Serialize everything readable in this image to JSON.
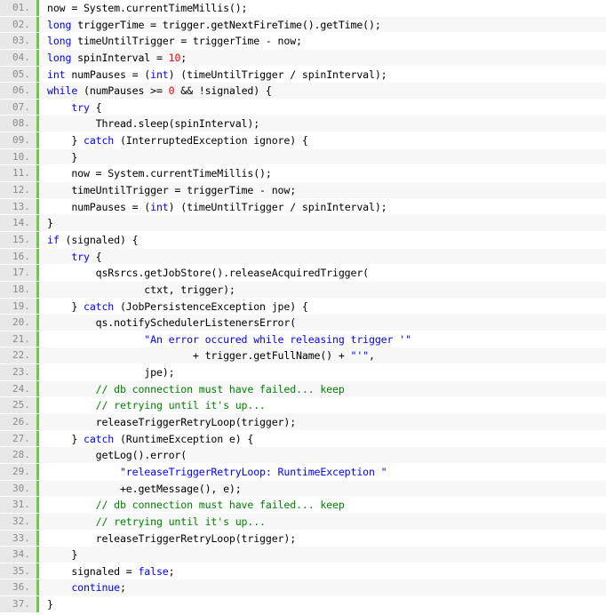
{
  "editor": {
    "accent_color": "#6ec84e",
    "keyword_color": "#0000ff",
    "comment_color": "#008200",
    "number_color": "#ff0000",
    "lines": [
      {
        "num": "01.",
        "tokens": [
          {
            "t": "now = System.currentTimeMillis();"
          }
        ]
      },
      {
        "num": "02.",
        "tokens": [
          {
            "t": "long",
            "c": "kw"
          },
          {
            "t": " triggerTime = trigger.getNextFireTime().getTime();"
          }
        ]
      },
      {
        "num": "03.",
        "tokens": [
          {
            "t": "long",
            "c": "kw"
          },
          {
            "t": " timeUntilTrigger = triggerTime - now;"
          }
        ]
      },
      {
        "num": "04.",
        "tokens": [
          {
            "t": "long",
            "c": "kw"
          },
          {
            "t": " spinInterval = "
          },
          {
            "t": "10",
            "c": "num"
          },
          {
            "t": ";"
          }
        ]
      },
      {
        "num": "05.",
        "tokens": [
          {
            "t": "int",
            "c": "kw"
          },
          {
            "t": " numPauses = ("
          },
          {
            "t": "int",
            "c": "kw"
          },
          {
            "t": ") (timeUntilTrigger / spinInterval);"
          }
        ]
      },
      {
        "num": "06.",
        "tokens": [
          {
            "t": "while",
            "c": "kw"
          },
          {
            "t": " (numPauses >= "
          },
          {
            "t": "0",
            "c": "num"
          },
          {
            "t": " && !signaled) {"
          }
        ]
      },
      {
        "num": "07.",
        "tokens": [
          {
            "t": "    "
          },
          {
            "t": "try",
            "c": "kw"
          },
          {
            "t": " {"
          }
        ]
      },
      {
        "num": "08.",
        "tokens": [
          {
            "t": "        Thread.sleep(spinInterval);"
          }
        ]
      },
      {
        "num": "09.",
        "tokens": [
          {
            "t": "    } "
          },
          {
            "t": "catch",
            "c": "kw"
          },
          {
            "t": " (InterruptedException ignore) {"
          }
        ]
      },
      {
        "num": "10.",
        "tokens": [
          {
            "t": "    }"
          }
        ]
      },
      {
        "num": "11.",
        "tokens": [
          {
            "t": "    now = System.currentTimeMillis();"
          }
        ]
      },
      {
        "num": "12.",
        "tokens": [
          {
            "t": "    timeUntilTrigger = triggerTime - now;"
          }
        ]
      },
      {
        "num": "13.",
        "tokens": [
          {
            "t": "    numPauses = ("
          },
          {
            "t": "int",
            "c": "kw"
          },
          {
            "t": ") (timeUntilTrigger / spinInterval);"
          }
        ]
      },
      {
        "num": "14.",
        "tokens": [
          {
            "t": "}"
          }
        ]
      },
      {
        "num": "15.",
        "tokens": [
          {
            "t": "if",
            "c": "kw"
          },
          {
            "t": " (signaled) {"
          }
        ]
      },
      {
        "num": "16.",
        "tokens": [
          {
            "t": "    "
          },
          {
            "t": "try",
            "c": "kw"
          },
          {
            "t": " {"
          }
        ]
      },
      {
        "num": "17.",
        "tokens": [
          {
            "t": "        qsRsrcs.getJobStore().releaseAcquiredTrigger("
          }
        ]
      },
      {
        "num": "18.",
        "tokens": [
          {
            "t": "                ctxt, trigger);"
          }
        ]
      },
      {
        "num": "19.",
        "tokens": [
          {
            "t": "    } "
          },
          {
            "t": "catch",
            "c": "kw"
          },
          {
            "t": " (JobPersistenceException jpe) {"
          }
        ]
      },
      {
        "num": "20.",
        "tokens": [
          {
            "t": "        qs.notifySchedulerListenersError("
          }
        ]
      },
      {
        "num": "21.",
        "tokens": [
          {
            "t": "                "
          },
          {
            "t": "\"An error occured while releasing trigger '\"",
            "c": "str"
          }
        ]
      },
      {
        "num": "22.",
        "tokens": [
          {
            "t": "                        + trigger.getFullName() + "
          },
          {
            "t": "\"'\"",
            "c": "str"
          },
          {
            "t": ","
          }
        ]
      },
      {
        "num": "23.",
        "tokens": [
          {
            "t": "                jpe);"
          }
        ]
      },
      {
        "num": "24.",
        "tokens": [
          {
            "t": "        "
          },
          {
            "t": "// db connection must have failed... keep",
            "c": "cmt"
          }
        ]
      },
      {
        "num": "25.",
        "tokens": [
          {
            "t": "        "
          },
          {
            "t": "// retrying until it's up...",
            "c": "cmt"
          }
        ]
      },
      {
        "num": "26.",
        "tokens": [
          {
            "t": "        releaseTriggerRetryLoop(trigger);"
          }
        ]
      },
      {
        "num": "27.",
        "tokens": [
          {
            "t": "    } "
          },
          {
            "t": "catch",
            "c": "kw"
          },
          {
            "t": " (RuntimeException e) {"
          }
        ]
      },
      {
        "num": "28.",
        "tokens": [
          {
            "t": "        getLog().error("
          }
        ]
      },
      {
        "num": "29.",
        "tokens": [
          {
            "t": "            "
          },
          {
            "t": "\"releaseTriggerRetryLoop: RuntimeException \"",
            "c": "str"
          }
        ]
      },
      {
        "num": "30.",
        "tokens": [
          {
            "t": "            +e.getMessage(), e);"
          }
        ]
      },
      {
        "num": "31.",
        "tokens": [
          {
            "t": "        "
          },
          {
            "t": "// db connection must have failed... keep",
            "c": "cmt"
          }
        ]
      },
      {
        "num": "32.",
        "tokens": [
          {
            "t": "        "
          },
          {
            "t": "// retrying until it's up...",
            "c": "cmt"
          }
        ]
      },
      {
        "num": "33.",
        "tokens": [
          {
            "t": "        releaseTriggerRetryLoop(trigger);"
          }
        ]
      },
      {
        "num": "34.",
        "tokens": [
          {
            "t": "    }"
          }
        ]
      },
      {
        "num": "35.",
        "tokens": [
          {
            "t": "    signaled = "
          },
          {
            "t": "false",
            "c": "kw"
          },
          {
            "t": ";"
          }
        ]
      },
      {
        "num": "36.",
        "tokens": [
          {
            "t": "    "
          },
          {
            "t": "continue",
            "c": "kw"
          },
          {
            "t": ";"
          }
        ]
      },
      {
        "num": "37.",
        "tokens": [
          {
            "t": "}"
          }
        ]
      }
    ]
  }
}
